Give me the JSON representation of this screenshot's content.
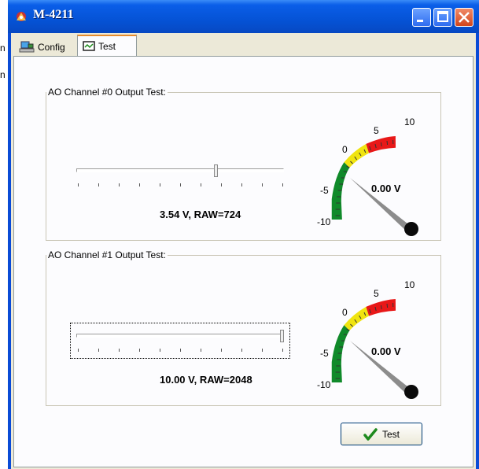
{
  "window": {
    "title": "M-4211"
  },
  "background_text": [
    "n",
    "n"
  ],
  "tabs": [
    {
      "label": "Config",
      "icon": "network-computer-icon"
    },
    {
      "label": "Test",
      "icon": "monitor-icon",
      "selected": true
    }
  ],
  "channels": [
    {
      "group_label": "AO Channel #0 Output Test:",
      "slider_fraction": 0.677,
      "value_text": "3.54 V, RAW=724",
      "gauge_labels": {
        "neg10": "-10",
        "neg5": "-5",
        "zero": "0",
        "five": "5",
        "ten": "10"
      },
      "gauge_value": "0.00 V"
    },
    {
      "group_label": "AO Channel #1 Output Test:",
      "slider_fraction": 1.0,
      "value_text": "10.00 V, RAW=2048",
      "gauge_labels": {
        "neg10": "-10",
        "neg5": "-5",
        "zero": "0",
        "five": "5",
        "ten": "10"
      },
      "gauge_value": "0.00 V"
    }
  ],
  "test_button": {
    "label": "Test",
    "icon": "checkmark-icon"
  },
  "colors": {
    "green": "#108a2a",
    "yellow": "#f0e410",
    "red": "#e81818",
    "needle": "#8c8c8c"
  }
}
